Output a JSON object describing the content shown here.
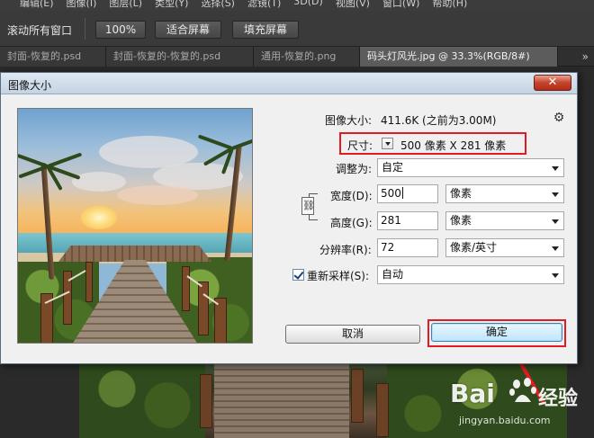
{
  "menubar": {
    "items": [
      "编辑(E)",
      "图像(I)",
      "图层(L)",
      "类型(Y)",
      "选择(S)",
      "滤镜(T)",
      "3D(D)",
      "视图(V)",
      "窗口(W)",
      "帮助(H)"
    ]
  },
  "optionsbar": {
    "scroll_all": "滚动所有窗口",
    "zoom_100": "100%",
    "fit_screen": "适合屏幕",
    "fill_screen": "填充屏幕"
  },
  "tabs": [
    {
      "label": "封面-恢复的.psd",
      "active": false
    },
    {
      "label": "封面-恢复的-恢复的.psd",
      "active": false
    },
    {
      "label": "通用-恢复的.png",
      "active": false
    },
    {
      "label": "码头灯风光.jpg @ 33.3%(RGB/8#)",
      "active": true
    }
  ],
  "tab_overflow": "»",
  "dialog": {
    "title": "图像大小",
    "close": "✕",
    "image_size_label": "图像大小:",
    "image_size_value": "411.6K (之前为3.00M)",
    "dimensions_label": "尺寸:",
    "dimensions_value": "500 像素  X  281 像素",
    "fit_label": "调整为:",
    "fit_value": "自定",
    "width_label": "宽度(D):",
    "width_value": "500",
    "width_unit": "像素",
    "height_label": "高度(G):",
    "height_value": "281",
    "height_unit": "像素",
    "resolution_label": "分辨率(R):",
    "resolution_value": "72",
    "resolution_unit": "像素/英寸",
    "resample_label": "重新采样(S):",
    "resample_value": "自动",
    "resample_checked": true,
    "cancel": "取消",
    "ok": "确定"
  },
  "watermark": {
    "logo": "Bai",
    "logo2": "du",
    "experience": "经验",
    "url": "jingyan.baidu.com"
  },
  "colors": {
    "highlight": "#e11b22",
    "dialog_bg": "#f0f0f0",
    "app_bg": "#2b2b2b"
  }
}
